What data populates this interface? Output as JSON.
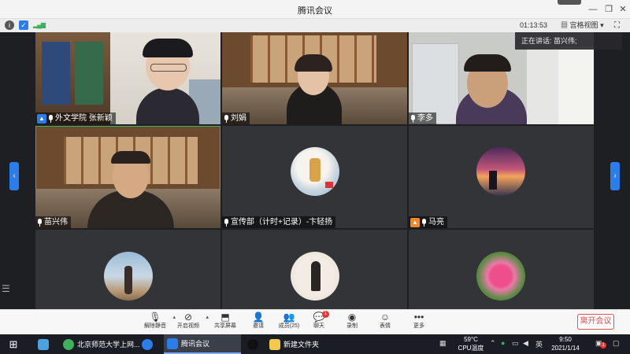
{
  "window": {
    "title": "腾讯会议"
  },
  "infobar": {
    "timer": "01:13:53",
    "view_label": "宫格视图"
  },
  "speaking": {
    "text": "正在讲话: 苗兴伟;"
  },
  "participants": [
    {
      "name": "外文学院 张新颖",
      "role": "host"
    },
    {
      "name": "刘娟"
    },
    {
      "name": "李多"
    },
    {
      "name": "苗兴伟"
    },
    {
      "name": "宣传部（计时+记录）-卞轻扬"
    },
    {
      "name": "马亮",
      "role": "cohost"
    },
    {
      "name": ""
    },
    {
      "name": ""
    },
    {
      "name": ""
    }
  ],
  "toolbar": {
    "items": [
      {
        "label": "解除静音",
        "icon": "mic-muted-icon"
      },
      {
        "label": "开启视频",
        "icon": "video-off-icon"
      },
      {
        "label": "共享屏幕",
        "icon": "share-screen-icon"
      },
      {
        "label": "邀请",
        "icon": "invite-icon"
      },
      {
        "label": "成员(25)",
        "icon": "members-icon"
      },
      {
        "label": "聊天",
        "icon": "chat-icon",
        "badge": "1"
      },
      {
        "label": "录制",
        "icon": "record-icon"
      },
      {
        "label": "表情",
        "icon": "emoji-icon"
      },
      {
        "label": "更多",
        "icon": "more-icon"
      }
    ],
    "leave_label": "离开会议"
  },
  "taskbar": {
    "browser_tab": "北京师范大学上网...",
    "meeting_tab": "腾讯会议",
    "folder_tab": "新建文件夹",
    "temp": "59°C",
    "temp_label": "CPU温度",
    "ime": "英",
    "time": "9:50",
    "date": "2021/1/14",
    "notification_count": "1"
  },
  "colors": {
    "accent": "#2b7de9",
    "speaking_border": "#3fb15c",
    "leave": "#e05050"
  }
}
